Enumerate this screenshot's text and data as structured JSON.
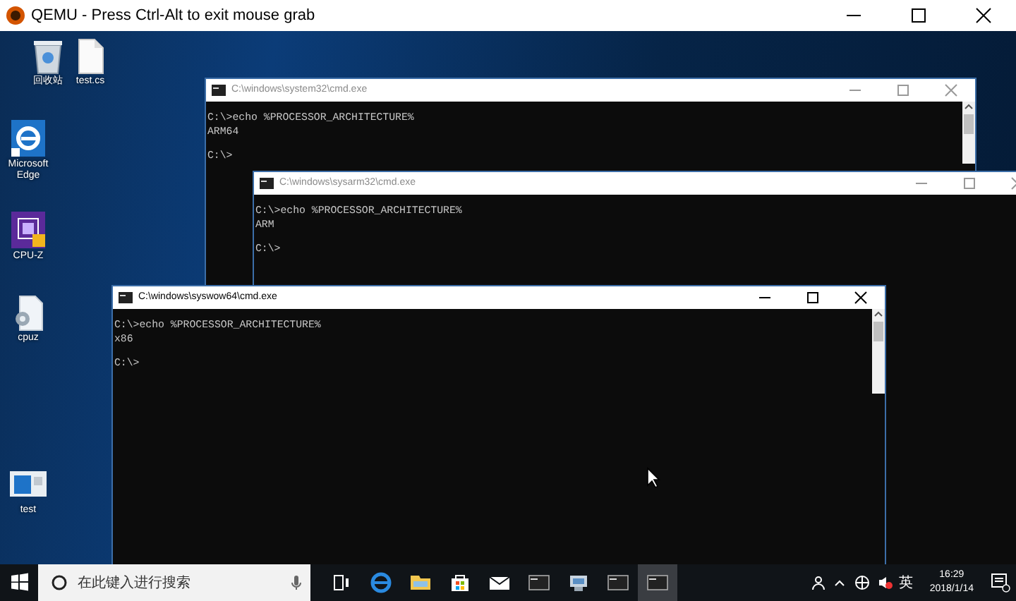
{
  "window": {
    "title": "QEMU - Press Ctrl-Alt to exit mouse grab"
  },
  "desktop_icons": [
    {
      "kind": "recycle",
      "label": "回收站"
    },
    {
      "kind": "file",
      "label": "test.cs"
    },
    {
      "kind": "edge",
      "label": "Microsoft Edge"
    },
    {
      "kind": "cpuz",
      "label": "CPU-Z"
    },
    {
      "kind": "setup",
      "label": "cpuz"
    },
    {
      "kind": "app",
      "label": "test"
    }
  ],
  "consoles": [
    {
      "title": "C:\\windows\\system32\\cmd.exe",
      "active": false,
      "command": "C:\\>echo %PROCESSOR_ARCHITECTURE%",
      "output": "ARM64",
      "prompt": "C:\\>"
    },
    {
      "title": "C:\\windows\\sysarm32\\cmd.exe",
      "active": false,
      "command": "C:\\>echo %PROCESSOR_ARCHITECTURE%",
      "output": "ARM",
      "prompt": "C:\\>"
    },
    {
      "title": "C:\\windows\\syswow64\\cmd.exe",
      "active": true,
      "command": "C:\\>echo %PROCESSOR_ARCHITECTURE%",
      "output": "x86",
      "prompt": "C:\\>"
    }
  ],
  "taskbar": {
    "search": {
      "placeholder": "在此键入进行搜索"
    },
    "apps": [
      {
        "kind": "taskview",
        "selected": false
      },
      {
        "kind": "edge",
        "selected": false
      },
      {
        "kind": "folder",
        "selected": false
      },
      {
        "kind": "store",
        "selected": false
      },
      {
        "kind": "mail",
        "selected": false
      },
      {
        "kind": "cmd",
        "selected": false
      },
      {
        "kind": "computer",
        "selected": false
      },
      {
        "kind": "cmd",
        "selected": false
      },
      {
        "kind": "cmd",
        "selected": true
      }
    ],
    "ime": "英",
    "time": "16:29",
    "date": "2018/1/14"
  }
}
